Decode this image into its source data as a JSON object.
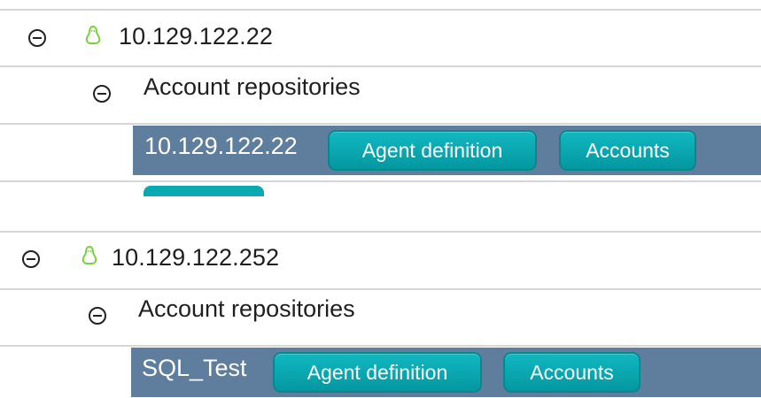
{
  "hosts": [
    {
      "ip": "10.129.122.22",
      "os_icon": "linux-tux-icon",
      "repos_label": "Account repositories",
      "repo_name": "10.129.122.22",
      "agent_button": "Agent definition",
      "accounts_button": "Accounts"
    },
    {
      "ip": "10.129.122.252",
      "os_icon": "linux-tux-icon",
      "repos_label": "Account repositories",
      "repo_name": "SQL_Test",
      "agent_button": "Agent definition",
      "accounts_button": "Accounts"
    }
  ],
  "colors": {
    "repo_bar": "#5f7d9d",
    "button": "#0aa9b2",
    "linux_icon": "#7bd23f"
  }
}
